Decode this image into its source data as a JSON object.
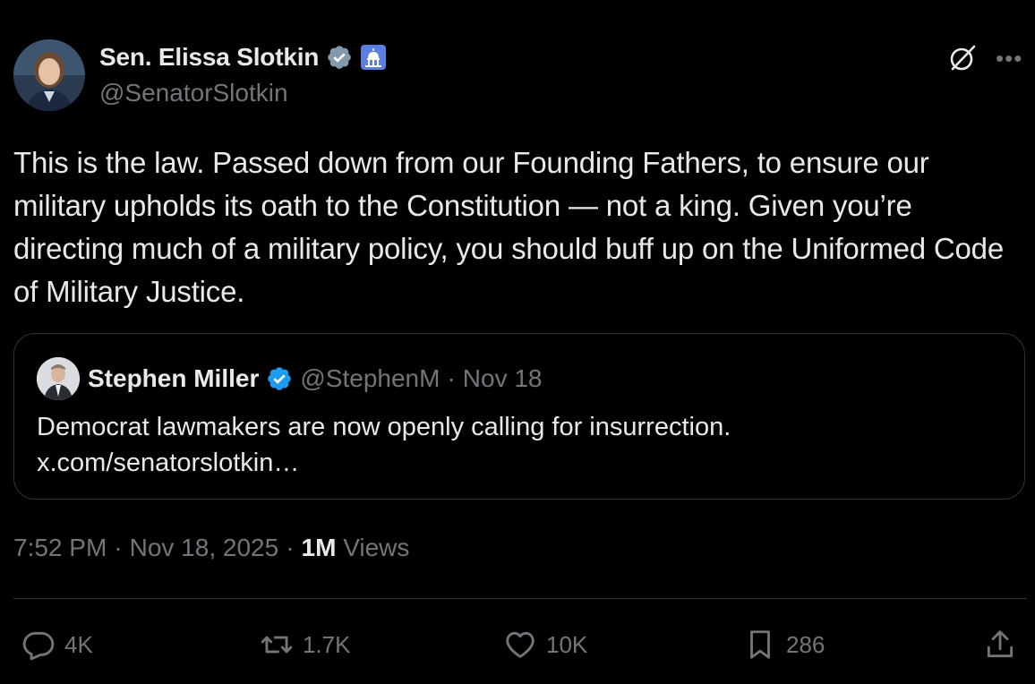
{
  "author": {
    "name": "Sen. Elissa Slotkin",
    "handle": "@SenatorSlotkin"
  },
  "tweet": {
    "text": "This is the law. Passed down from our Founding Fathers, to ensure our military upholds its oath to the Constitution — not a king. Given you’re directing much of a military policy, you should buff up on the Uniformed Code of Military Justice."
  },
  "quoted": {
    "name": "Stephen Miller",
    "handle": "@StephenM",
    "separator": "·",
    "date": "Nov 18",
    "text_line1": "Democrat lawmakers are now openly calling for insurrection.",
    "text_line2": "x.com/senatorslotkin…"
  },
  "meta": {
    "time": "7:52 PM",
    "sep1": "·",
    "date": "Nov 18, 2025",
    "sep2": "·",
    "views_count": "1M",
    "views_label": "Views"
  },
  "actions": {
    "replies": "4K",
    "reposts": "1.7K",
    "likes": "10K",
    "bookmarks": "286"
  },
  "colors": {
    "background": "#000000",
    "text": "#e7e9ea",
    "muted": "#71767b",
    "border": "#2f3336",
    "verified_gray": "#829aab",
    "verified_blue": "#1d9bf0"
  },
  "icons": [
    "verified-gray-badge-icon",
    "capitol-emoji-icon",
    "grok-icon",
    "more-icon",
    "verified-blue-badge-icon",
    "reply-icon",
    "repost-icon",
    "like-icon",
    "bookmark-icon",
    "share-icon"
  ]
}
